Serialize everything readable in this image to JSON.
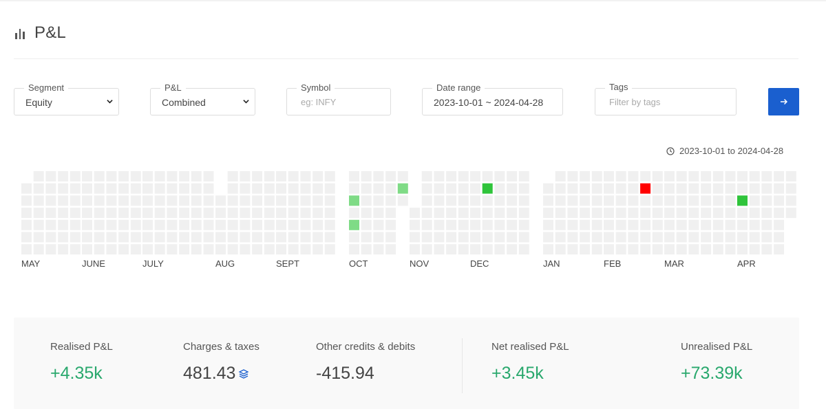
{
  "header": {
    "title": "P&L",
    "icon": "bar-chart-icon"
  },
  "filters": {
    "segment": {
      "label": "Segment",
      "value": "Equity"
    },
    "pnl": {
      "label": "P&L",
      "value": "Combined"
    },
    "symbol": {
      "label": "Symbol",
      "placeholder": "eg: INFY"
    },
    "date_range": {
      "label": "Date range",
      "value": "2023-10-01 ~ 2024-04-28"
    },
    "tags": {
      "label": "Tags",
      "placeholder": "Filter by tags"
    },
    "submit_icon": "arrow-right-icon",
    "submit_color": "#1a5fcf"
  },
  "range_note": "2023-10-01 to 2024-04-28",
  "heatmap": {
    "months": [
      "MAY",
      "JUNE",
      "JULY",
      "AUG",
      "SEPT",
      "OCT",
      "NOV",
      "DEC",
      "JAN",
      "FEB",
      "MAR",
      "APR"
    ],
    "colors": {
      "empty": "#f0f0f0",
      "profit_low": "#7fdb86",
      "profit_high": "#2fc43b",
      "loss": "#ff0000"
    },
    "highlights": [
      {
        "month": "OCT",
        "week": 0,
        "day": 2,
        "level": "profit_low"
      },
      {
        "month": "OCT",
        "week": 0,
        "day": 4,
        "level": "profit_low"
      },
      {
        "month": "OCT",
        "week": 4,
        "day": 1,
        "level": "profit_low"
      },
      {
        "month": "DEC",
        "week": 1,
        "day": 1,
        "level": "profit_high"
      },
      {
        "month": "FEB",
        "week": 3,
        "day": 1,
        "level": "loss"
      },
      {
        "month": "APR",
        "week": 0,
        "day": 2,
        "level": "profit_high"
      }
    ]
  },
  "summary": {
    "realised": {
      "label": "Realised P&L",
      "value": "+4.35k"
    },
    "charges": {
      "label": "Charges & taxes",
      "value": "481.43",
      "icon": "layers-icon"
    },
    "other": {
      "label": "Other credits & debits",
      "value": "-415.94"
    },
    "net": {
      "label": "Net realised P&L",
      "value": "+3.45k"
    },
    "unrealised": {
      "label": "Unrealised P&L",
      "value": "+73.39k"
    }
  }
}
